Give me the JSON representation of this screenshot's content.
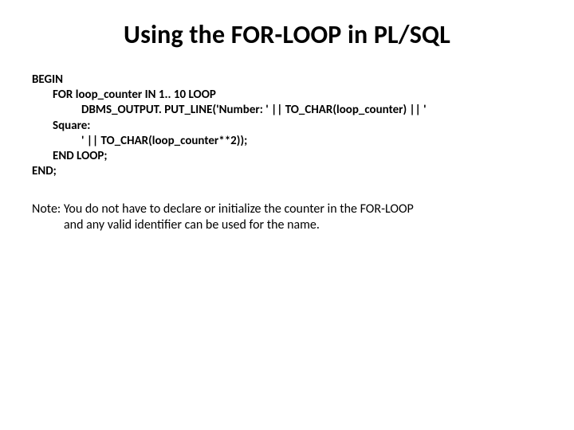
{
  "title": "Using the FOR-LOOP in PL/SQL",
  "code": {
    "l1": "BEGIN",
    "l2": "FOR loop_counter IN 1.. 10 LOOP",
    "l3": "DBMS_OUTPUT. PUT_LINE('Number: ' || TO_CHAR(loop_counter) || '",
    "l4": "Square:",
    "l5": "' || TO_CHAR(loop_counter**2));",
    "l6": "END LOOP;",
    "l7": "END;"
  },
  "note": {
    "line1a": "Note: You do not have to declare or initialize the counter in the FOR-LOOP",
    "line2": "and any valid identifier can be used for the name."
  }
}
